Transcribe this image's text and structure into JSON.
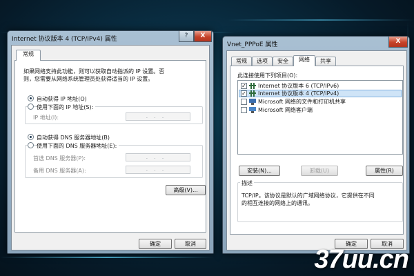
{
  "left_window": {
    "title": "Internet 协议版本 4 (TCP/IPv4) 属性",
    "help_label": "?",
    "close_label": "X",
    "tab": "常规",
    "intro_line1": "如果网络支持此功能，则可以获取自动指派的 IP 设置。否",
    "intro_line2": "则，您需要从网络系统管理员处获得适当的 IP 设置。",
    "auto_ip_label": "自动获得 IP 地址(O)",
    "manual_ip_label": "使用下面的 IP 地址(S):",
    "ip_address_label": "IP 地址(I):",
    "auto_dns_label": "自动获得 DNS 服务器地址(B)",
    "manual_dns_label": "使用下面的 DNS 服务器地址(E):",
    "preferred_dns_label": "首选 DNS 服务器(P):",
    "alternate_dns_label": "备用 DNS 服务器(A):",
    "ip_placeholder": "...",
    "advanced_button": "高级(V)...",
    "ok_button": "确定",
    "cancel_button": "取消"
  },
  "right_window": {
    "title": "Vnet_PPPoE 属性",
    "close_label": "X",
    "tabs": [
      "常规",
      "选项",
      "安全",
      "网络",
      "共享"
    ],
    "active_tab": "网络",
    "list_heading": "此连接使用下列项目(O):",
    "items": [
      {
        "label": "Internet 协议版本 6 (TCP/IPv6)",
        "checked": true,
        "icon": "protocol-icon"
      },
      {
        "label": "Internet 协议版本 4 (TCP/IPv4)",
        "checked": true,
        "icon": "protocol-icon"
      },
      {
        "label": "Microsoft 网络的文件和打印机共享",
        "checked": false,
        "icon": "network-service-icon"
      },
      {
        "label": "Microsoft 网络客户端",
        "checked": false,
        "icon": "network-client-icon"
      }
    ],
    "install_button": "安装(N)...",
    "uninstall_button": "卸载(U)",
    "properties_button": "属性(R)",
    "description_title": "描述",
    "description_line1": "TCP/IP。该协议是默认的广域网络协议，它提供在不同",
    "description_line2": "的相互连接的网络上的通讯。",
    "ok_button": "确定",
    "cancel_button": "取消"
  },
  "watermark": "37uu.cn",
  "colors": {
    "background": "#0a2f44",
    "glow": "#5fd7ff",
    "selection": "#cfe4f7"
  }
}
